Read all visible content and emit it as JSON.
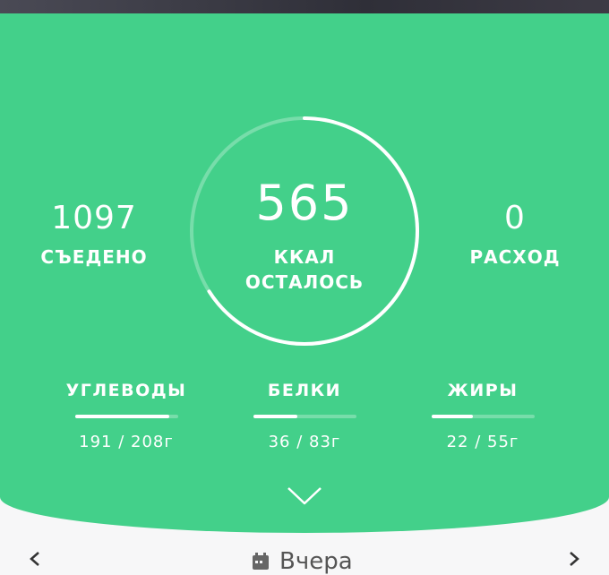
{
  "summary": {
    "eaten_value": "1097",
    "eaten_label": "СЪЕДЕНО",
    "remaining_value": "565",
    "remaining_unit": "ККАЛ",
    "remaining_label": "ОСТАЛОСЬ",
    "burned_value": "0",
    "burned_label": "РАСХОД",
    "ring_progress": 0.66
  },
  "macros": [
    {
      "name": "УГЛЕВОДЫ",
      "amount": "191 / 208г",
      "progress": 0.92
    },
    {
      "name": "БЕЛКИ",
      "amount": "36 / 83г",
      "progress": 0.43
    },
    {
      "name": "ЖИРЫ",
      "amount": "22 / 55г",
      "progress": 0.4
    }
  ],
  "date_nav": {
    "label": "Вчера",
    "icons": [
      "chevron-left-icon",
      "calendar-icon",
      "chevron-right-icon"
    ]
  },
  "colors": {
    "accent": "#43d08a",
    "text_light": "#ffffff"
  }
}
